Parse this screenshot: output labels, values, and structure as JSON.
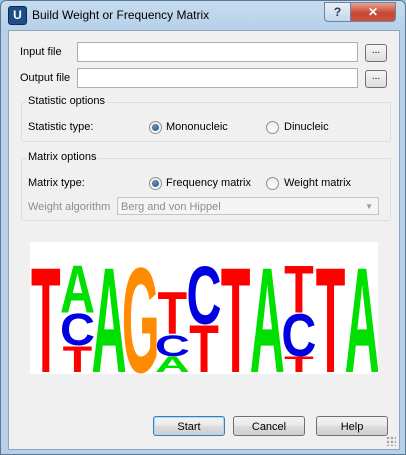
{
  "window": {
    "title": "Build Weight or Frequency Matrix",
    "app_icon_letter": "U",
    "help_glyph": "?",
    "close_glyph": "✕"
  },
  "files": {
    "input_label": "Input file",
    "input_value": "",
    "output_label": "Output file",
    "output_value": "",
    "browse_label": "..."
  },
  "statistic": {
    "group_title": "Statistic options",
    "type_label": "Statistic type:",
    "options": [
      "Mononucleic",
      "Dinucleic"
    ],
    "selected": "Mononucleic"
  },
  "matrix": {
    "group_title": "Matrix options",
    "type_label": "Matrix type:",
    "options": [
      "Frequency matrix",
      "Weight matrix"
    ],
    "selected": "Frequency matrix",
    "algorithm_label": "Weight algorithm",
    "algorithm_value": "Berg and von Hippel",
    "algorithm_enabled": false
  },
  "logo": {
    "colors": {
      "A": "#00e000",
      "C": "#0000e0",
      "G": "#ff8c00",
      "T": "#ff0000"
    },
    "positions": [
      [
        {
          "base": "T",
          "share": 1.0
        }
      ],
      [
        {
          "base": "A",
          "share": 0.45
        },
        {
          "base": "C",
          "share": 0.3
        },
        {
          "base": "T",
          "share": 0.25
        }
      ],
      [
        {
          "base": "A",
          "share": 1.0
        }
      ],
      [
        {
          "base": "G",
          "share": 1.0
        }
      ],
      [
        {
          "base": "T",
          "share": 0.4
        },
        {
          "base": "C",
          "share": 0.2
        },
        {
          "base": "A",
          "share": 0.15
        }
      ],
      [
        {
          "base": "T",
          "share": 0.45
        },
        {
          "base": "C",
          "share": 0.55
        }
      ],
      [
        {
          "base": "T",
          "share": 1.0
        }
      ],
      [
        {
          "base": "A",
          "share": 1.0
        }
      ],
      [
        {
          "base": "T",
          "share": 0.45
        },
        {
          "base": "T",
          "share": 0.15
        },
        {
          "base": "C",
          "share": 0.4
        }
      ],
      [
        {
          "base": "T",
          "share": 1.0
        }
      ],
      [
        {
          "base": "A",
          "share": 1.0
        }
      ]
    ]
  },
  "buttons": {
    "start": "Start",
    "cancel": "Cancel",
    "help": "Help"
  }
}
